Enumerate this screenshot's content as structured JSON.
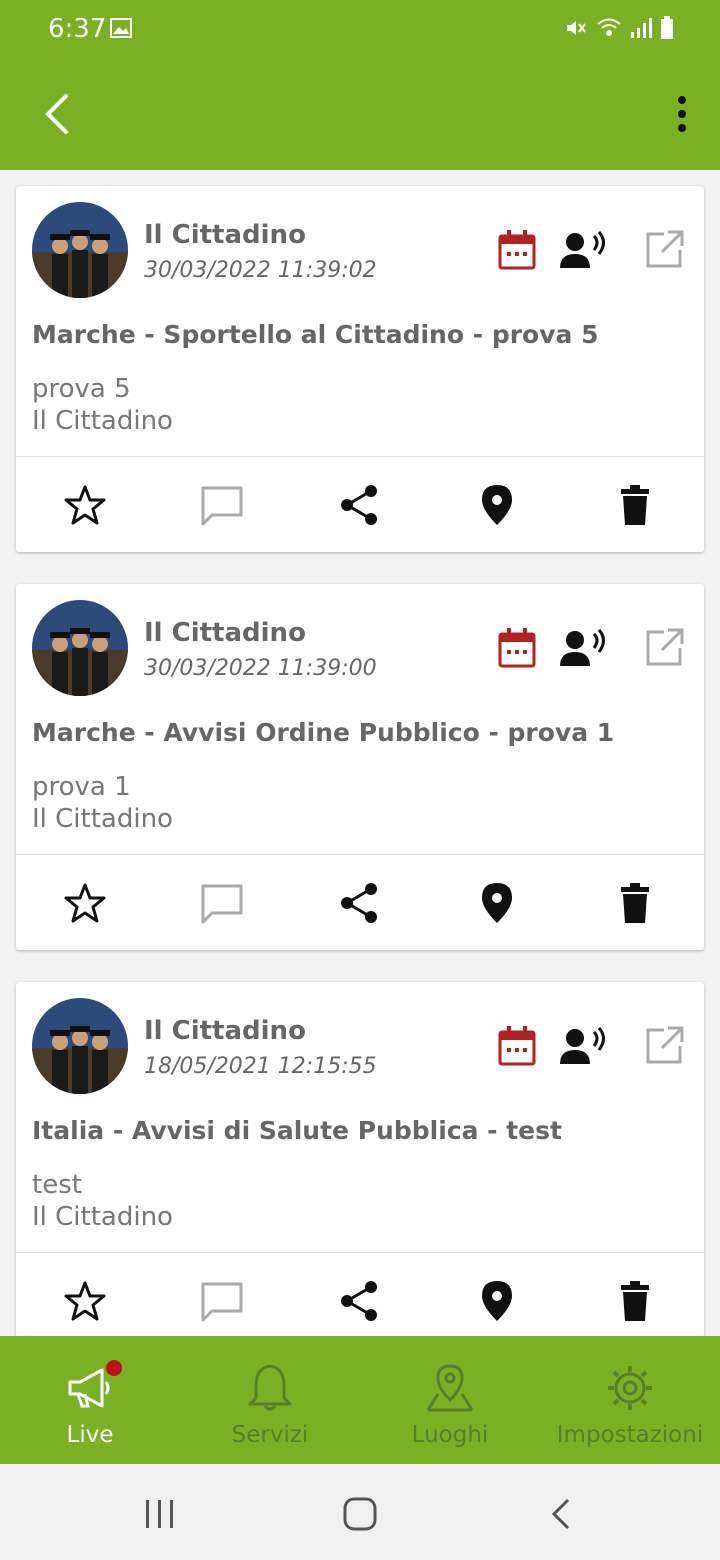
{
  "status": {
    "time": "6:37",
    "icons": [
      "image-icon",
      "mute-icon",
      "wifi-icon",
      "signal-icon",
      "battery-icon"
    ]
  },
  "appbar": {
    "back_icon": "chevron-left-icon",
    "more_icon": "more-vert-icon"
  },
  "colors": {
    "brand": "#7ab124",
    "accent_red": "#b22222",
    "text_gray": "#666666",
    "inactive_nav": "#5a7e2a"
  },
  "posts": [
    {
      "author": "Il Cittadino",
      "date": "30/03/2022 11:39:02",
      "title": "Marche - Sportello al Cittadino - prova 5",
      "body_line1": "prova 5",
      "body_line2": "Il Cittadino"
    },
    {
      "author": "Il Cittadino",
      "date": "30/03/2022 11:39:00",
      "title": "Marche - Avvisi Ordine Pubblico - prova 1",
      "body_line1": "prova 1",
      "body_line2": "Il Cittadino"
    },
    {
      "author": "Il Cittadino",
      "date": "18/05/2021 12:15:55",
      "title": "Italia - Avvisi di Salute Pubblica - test",
      "body_line1": "test",
      "body_line2": "Il Cittadino"
    }
  ],
  "nav": {
    "live": "Live",
    "servizi": "Servizi",
    "luoghi": "Luoghi",
    "impostazioni": "Impostazioni"
  }
}
